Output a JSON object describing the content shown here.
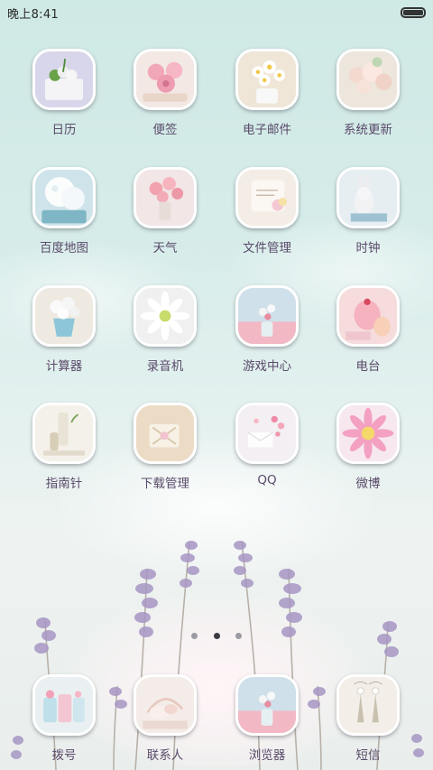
{
  "status_bar": {
    "time": "晚上8:41",
    "battery_level": 1.0
  },
  "apps": [
    {
      "label": "日历",
      "icon": "calendar-icon"
    },
    {
      "label": "便签",
      "icon": "notes-icon"
    },
    {
      "label": "电子邮件",
      "icon": "email-icon"
    },
    {
      "label": "系统更新",
      "icon": "system-update-icon"
    },
    {
      "label": "百度地图",
      "icon": "baidu-map-icon"
    },
    {
      "label": "天气",
      "icon": "weather-icon"
    },
    {
      "label": "文件管理",
      "icon": "file-manager-icon"
    },
    {
      "label": "时钟",
      "icon": "clock-icon"
    },
    {
      "label": "计算器",
      "icon": "calculator-icon"
    },
    {
      "label": "录音机",
      "icon": "recorder-icon"
    },
    {
      "label": "游戏中心",
      "icon": "game-center-icon"
    },
    {
      "label": "电台",
      "icon": "radio-icon"
    },
    {
      "label": "指南针",
      "icon": "compass-icon"
    },
    {
      "label": "下载管理",
      "icon": "download-manager-icon"
    },
    {
      "label": "QQ",
      "icon": "qq-icon"
    },
    {
      "label": "微博",
      "icon": "weibo-icon"
    }
  ],
  "page_indicator": {
    "total": 3,
    "current": 2
  },
  "dock": [
    {
      "label": "拨号",
      "icon": "phone-dialer-icon"
    },
    {
      "label": "联系人",
      "icon": "contacts-icon"
    },
    {
      "label": "浏览器",
      "icon": "browser-icon"
    },
    {
      "label": "短信",
      "icon": "messages-icon"
    }
  ]
}
